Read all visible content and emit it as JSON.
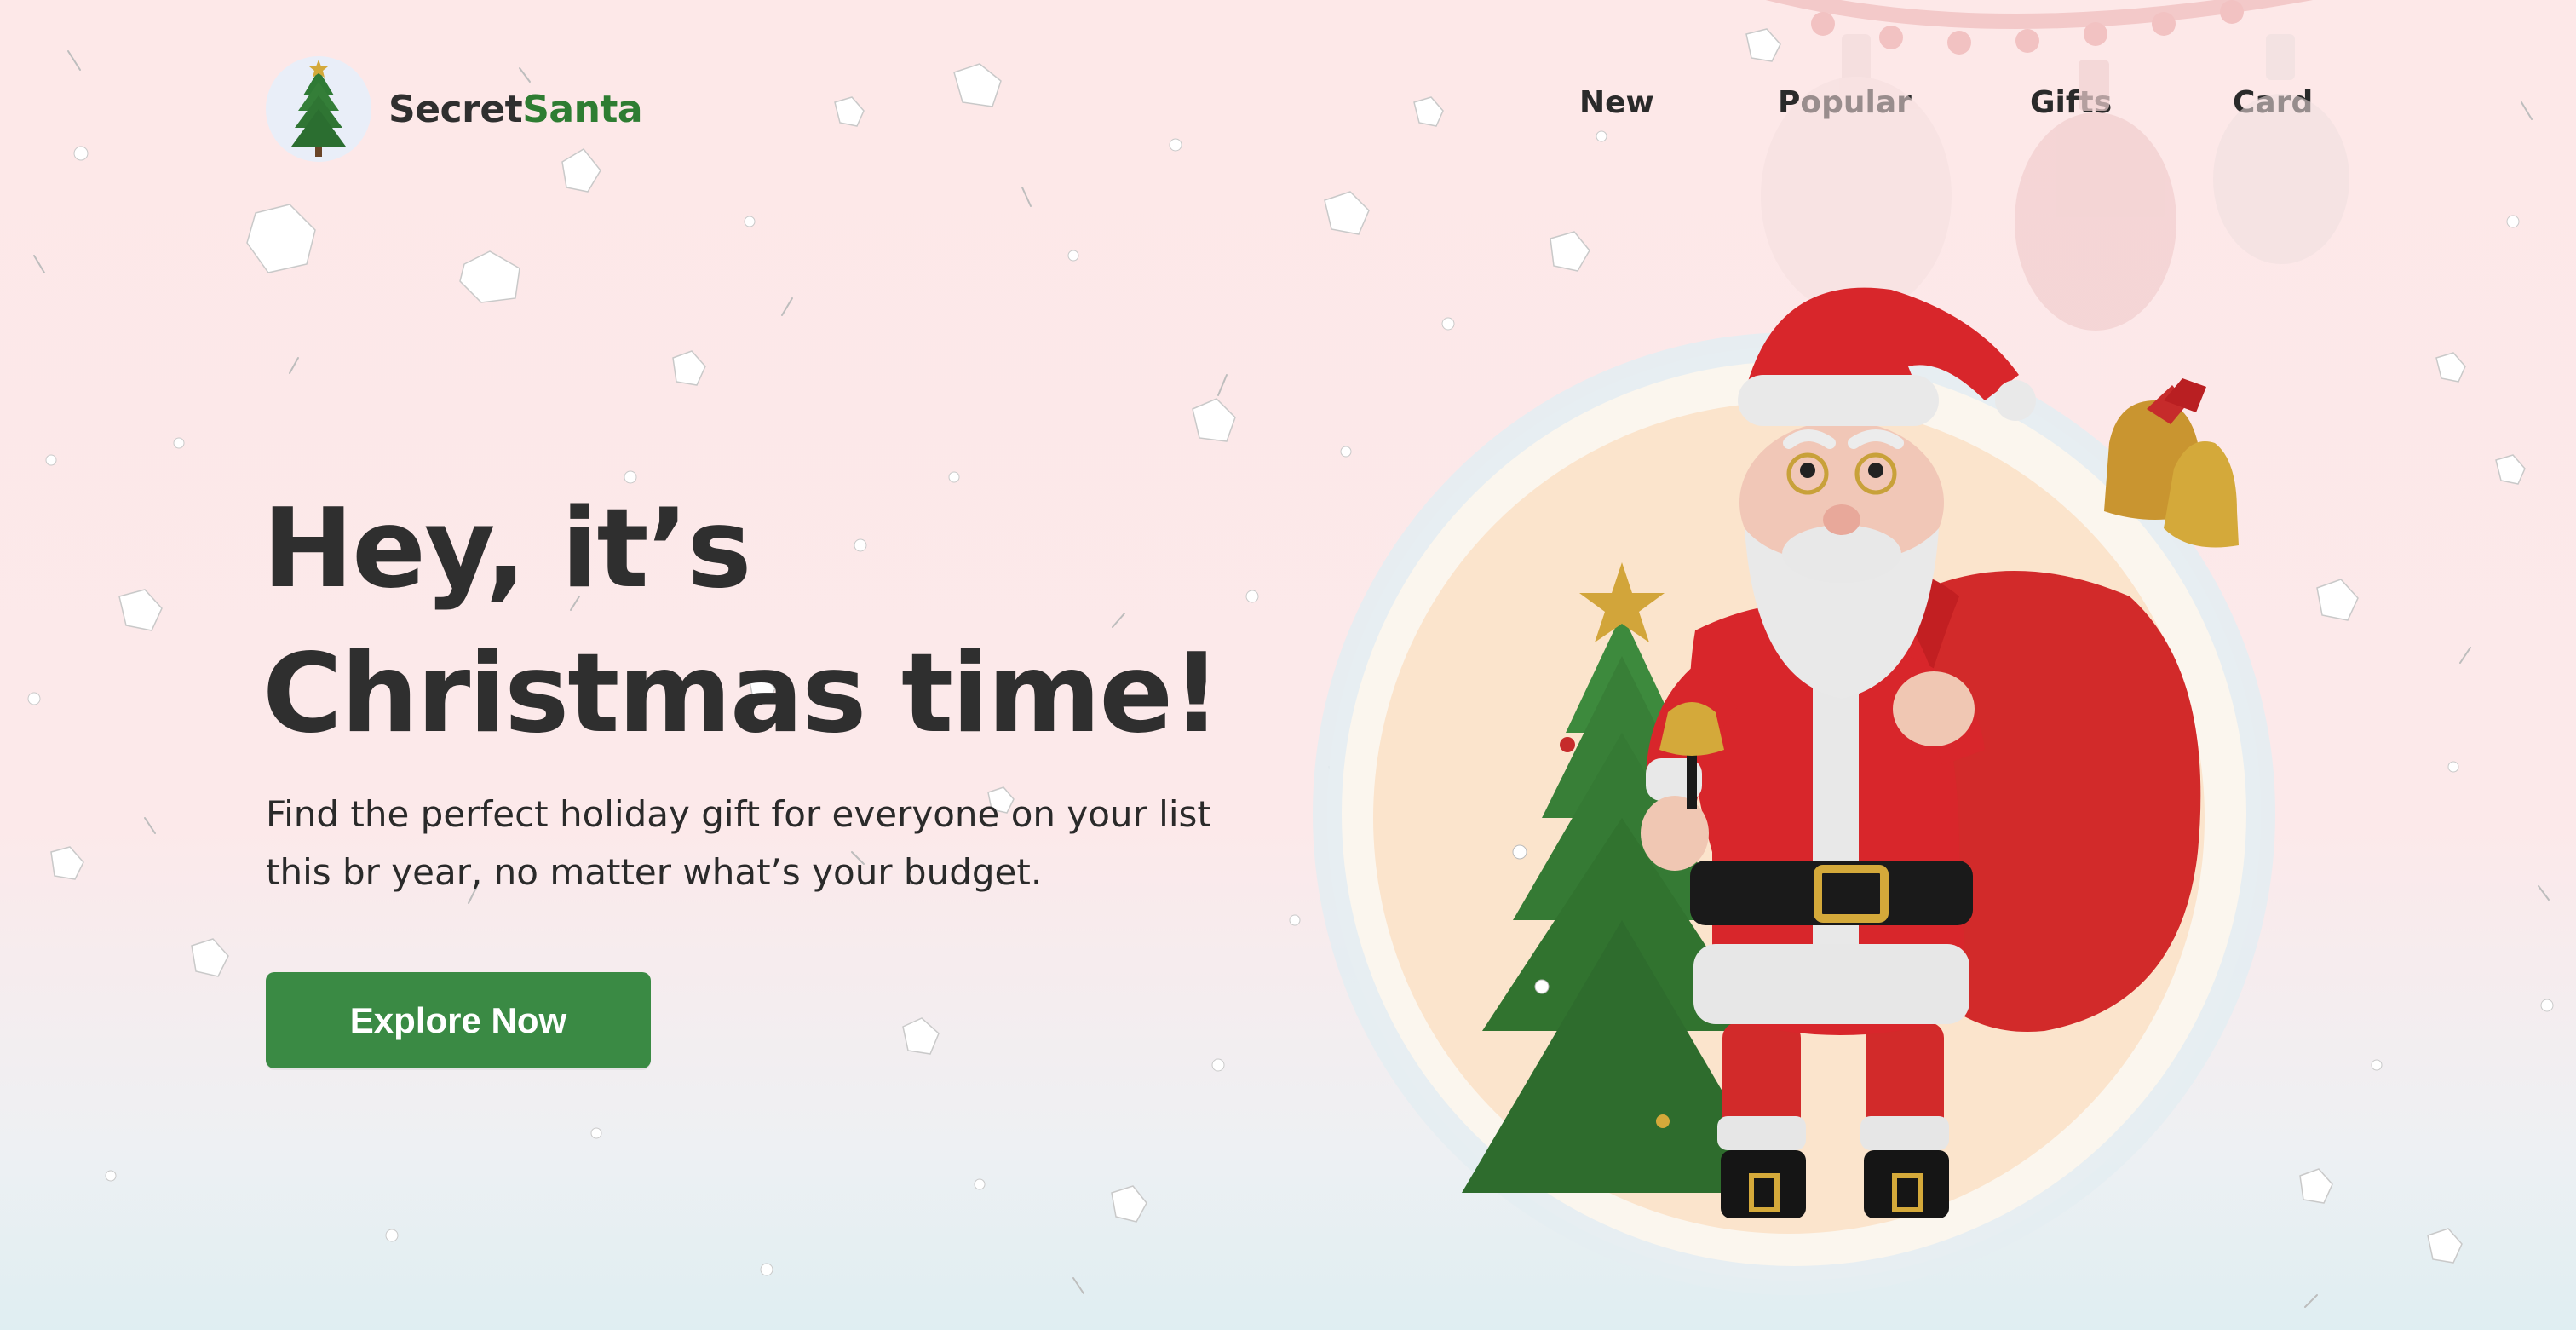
{
  "brand": {
    "name_part1": "Secret",
    "name_part2": "Santa",
    "logo_icon": "christmas-tree-icon"
  },
  "nav": {
    "items": [
      {
        "label": "New"
      },
      {
        "label": "Popular"
      },
      {
        "label": "Gifts"
      },
      {
        "label": "Card"
      }
    ]
  },
  "hero": {
    "title_line1": "Hey, it’s",
    "title_line2": "Christmas time!",
    "subtitle_line1": "Find the perfect holiday gift for everyone on your list",
    "subtitle_line2": "this br year, no matter what’s your budget.",
    "cta_label": "Explore Now"
  },
  "colors": {
    "background": "#fde8e8",
    "accent_green": "#3a8a44",
    "brand_green": "#2e7d32",
    "text": "#2f2f2f",
    "santa_red": "#d8262b"
  },
  "illustration": {
    "icons": [
      "santa-claus-icon",
      "gift-sack-icon",
      "christmas-tree-icon",
      "jingle-bell-icon",
      "light-bulb-icon"
    ]
  }
}
